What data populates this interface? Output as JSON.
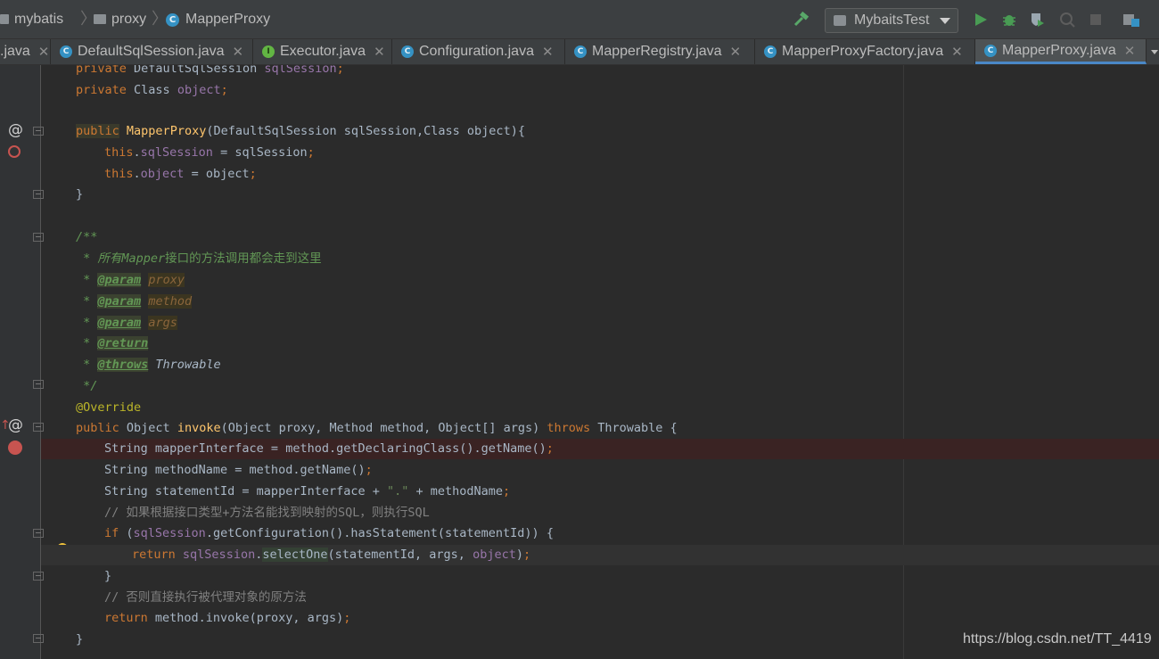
{
  "breadcrumb": [
    "mybatis",
    "proxy",
    "MapperProxy"
  ],
  "run_config": "MybaitsTest",
  "tabs": [
    {
      "label": ".java"
    },
    {
      "label": "DefaultSqlSession.java"
    },
    {
      "label": "Executor.java"
    },
    {
      "label": "Configuration.java"
    },
    {
      "label": "MapperRegistry.java"
    },
    {
      "label": "MapperProxyFactory.java"
    },
    {
      "label": "MapperProxy.java"
    }
  ],
  "watermark": "https://blog.csdn.net/TT_4419",
  "code": {
    "l1": [
      "private",
      " DefaultSqlSession ",
      "sqlSession",
      ";"
    ],
    "l2": [
      "private",
      " Class ",
      "object",
      ";"
    ],
    "l3": [
      "public",
      "MapperProxy",
      "(DefaultSqlSession sqlSession,Class object){"
    ],
    "l4": [
      "this",
      ".",
      "sqlSession",
      " = sqlSession",
      ";"
    ],
    "l5": [
      "this",
      ".",
      "object",
      " = object",
      ";"
    ],
    "l6": "}",
    "l7": "/**",
    "l8": [
      " * 所有",
      "Mapper",
      "接口的方法调用都会走到这里"
    ],
    "l9": [
      " * ",
      "@param",
      " ",
      "proxy"
    ],
    "l10": [
      " * ",
      "@param",
      " ",
      "method"
    ],
    "l11": [
      " * ",
      "@param",
      " ",
      "args"
    ],
    "l12": [
      " * ",
      "@return"
    ],
    "l13": [
      " * ",
      "@throws",
      " Throwable"
    ],
    "l14": " */",
    "l15": "@Override",
    "l16": [
      "public",
      " Object ",
      "invoke",
      "(Object proxy, Method method, Object[] args) ",
      "throws",
      " Throwable {"
    ],
    "l17": [
      "String mapperInterface = method.getDeclaringClass().getName()",
      ";"
    ],
    "l18": [
      "String methodName = method.getName()",
      ";"
    ],
    "l19": [
      "String statementId = mapperInterface + ",
      "\".\"",
      " + methodName",
      ";"
    ],
    "l20": "// 如果根据接口类型+方法名能找到映射的SQL，则执行SQL",
    "l21": [
      "if",
      " (",
      "sqlSession",
      ".getConfiguration().hasStatement(statementId)) {"
    ],
    "l22": [
      "return",
      " ",
      "sqlSession",
      ".",
      "selectOne",
      "(statementId, args, ",
      "object",
      ")",
      ";"
    ],
    "l23": "}",
    "l24": "// 否则直接执行被代理对象的原方法",
    "l25": [
      "return",
      " method.invoke(proxy, args)",
      ";"
    ],
    "l26": "}"
  }
}
